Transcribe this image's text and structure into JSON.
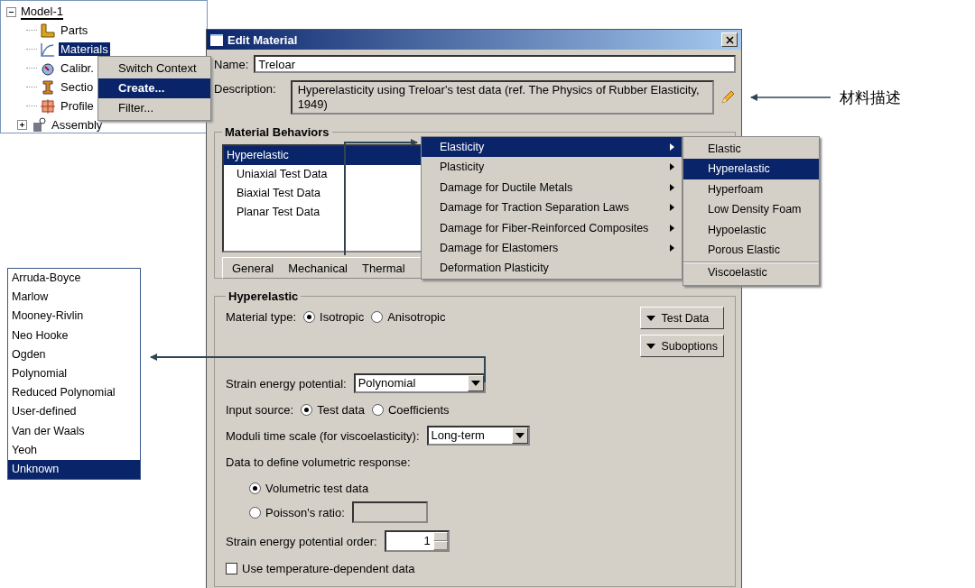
{
  "model_tree": {
    "root": "Model-1",
    "expanded": true,
    "items": [
      {
        "label": "Parts",
        "kind": "leaf",
        "selected": false
      },
      {
        "label": "Materials",
        "kind": "leaf",
        "selected": true
      },
      {
        "label": "Calibr.",
        "kind": "leaf",
        "selected": false
      },
      {
        "label": "Sectio",
        "kind": "leaf",
        "selected": false
      },
      {
        "label": "Profile",
        "kind": "leaf",
        "selected": false
      },
      {
        "label": "Assembly",
        "kind": "collapsed",
        "selected": false
      }
    ]
  },
  "context_menu": {
    "items": [
      {
        "label": "Switch Context",
        "selected": false
      },
      {
        "label": "Create...",
        "selected": true
      },
      {
        "label": "Filter...",
        "selected": false
      }
    ]
  },
  "dialog": {
    "title": "Edit Material",
    "name": {
      "label": "Name:",
      "value": "Treloar"
    },
    "description": {
      "label": "Description:",
      "value": "Hyperelasticity using Treloar's test data (ref. The Physics of Rubber Elasticity, 1949)"
    },
    "behaviors": {
      "title": "Material Behaviors",
      "items": [
        {
          "label": "Hyperelastic",
          "selected": true,
          "children": [
            {
              "label": "Uniaxial Test Data",
              "selected": false
            },
            {
              "label": "Biaxial Test Data",
              "selected": false
            },
            {
              "label": "Planar Test Data",
              "selected": false
            }
          ]
        }
      ],
      "menu_tabs": [
        "General",
        "Mechanical",
        "Thermal"
      ]
    },
    "hyperelastic": {
      "title": "Hyperelastic",
      "material_type": {
        "label": "Material type:",
        "options": [
          {
            "label": "Isotropic",
            "selected": true
          },
          {
            "label": "Anisotropic",
            "selected": false
          }
        ]
      },
      "buttons": [
        "Test Data",
        "Suboptions"
      ],
      "strain_energy": {
        "label": "Strain energy potential:",
        "value": "Polynomial"
      },
      "input_source": {
        "label": "Input source:",
        "options": [
          {
            "label": "Test data",
            "selected": true
          },
          {
            "label": "Coefficients",
            "selected": false
          }
        ]
      },
      "moduli": {
        "label": "Moduli time scale (for viscoelasticity):",
        "value": "Long-term"
      },
      "volumetric": {
        "label": "Data to define volumetric response:",
        "options": [
          {
            "label": "Volumetric test data",
            "selected": true
          },
          {
            "label": "Poisson's ratio:",
            "selected": false
          }
        ]
      },
      "order": {
        "label": "Strain energy potential order:",
        "value": "1"
      },
      "temperature": {
        "label": "Use temperature-dependent data",
        "checked": false
      }
    }
  },
  "mechanical_menu": {
    "items": [
      {
        "label": "Elasticity",
        "selected": true,
        "submenu": true
      },
      {
        "label": "Plasticity",
        "selected": false,
        "submenu": true
      },
      {
        "label": "Damage for Ductile Metals",
        "selected": false,
        "submenu": true
      },
      {
        "label": "Damage for Traction Separation Laws",
        "selected": false,
        "submenu": true
      },
      {
        "label": "Damage for Fiber-Reinforced Composites",
        "selected": false,
        "submenu": true
      },
      {
        "label": "Damage for Elastomers",
        "selected": false,
        "submenu": true
      },
      {
        "label": "Deformation Plasticity",
        "selected": false,
        "submenu": false
      }
    ]
  },
  "elasticity_submenu": {
    "items": [
      {
        "label": "Elastic",
        "selected": false,
        "separator_before": false
      },
      {
        "label": "Hyperelastic",
        "selected": true,
        "separator_before": false
      },
      {
        "label": "Hyperfoam",
        "selected": false,
        "separator_before": false
      },
      {
        "label": "Low Density Foam",
        "selected": false,
        "separator_before": false
      },
      {
        "label": "Hypoelastic",
        "selected": false,
        "separator_before": false
      },
      {
        "label": "Porous Elastic",
        "selected": false,
        "separator_before": false
      },
      {
        "label": "Viscoelastic",
        "selected": false,
        "separator_before": true
      }
    ]
  },
  "potential_list": {
    "items": [
      {
        "label": "Arruda-Boyce",
        "selected": false
      },
      {
        "label": "Marlow",
        "selected": false
      },
      {
        "label": "Mooney-Rivlin",
        "selected": false
      },
      {
        "label": "Neo Hooke",
        "selected": false
      },
      {
        "label": "Ogden",
        "selected": false
      },
      {
        "label": "Polynomial",
        "selected": false
      },
      {
        "label": "Reduced Polynomial",
        "selected": false
      },
      {
        "label": "User-defined",
        "selected": false
      },
      {
        "label": "Van der Waals",
        "selected": false
      },
      {
        "label": "Yeoh",
        "selected": false
      },
      {
        "label": "Unknown",
        "selected": true
      }
    ]
  },
  "callout": {
    "label": "材料描述"
  }
}
